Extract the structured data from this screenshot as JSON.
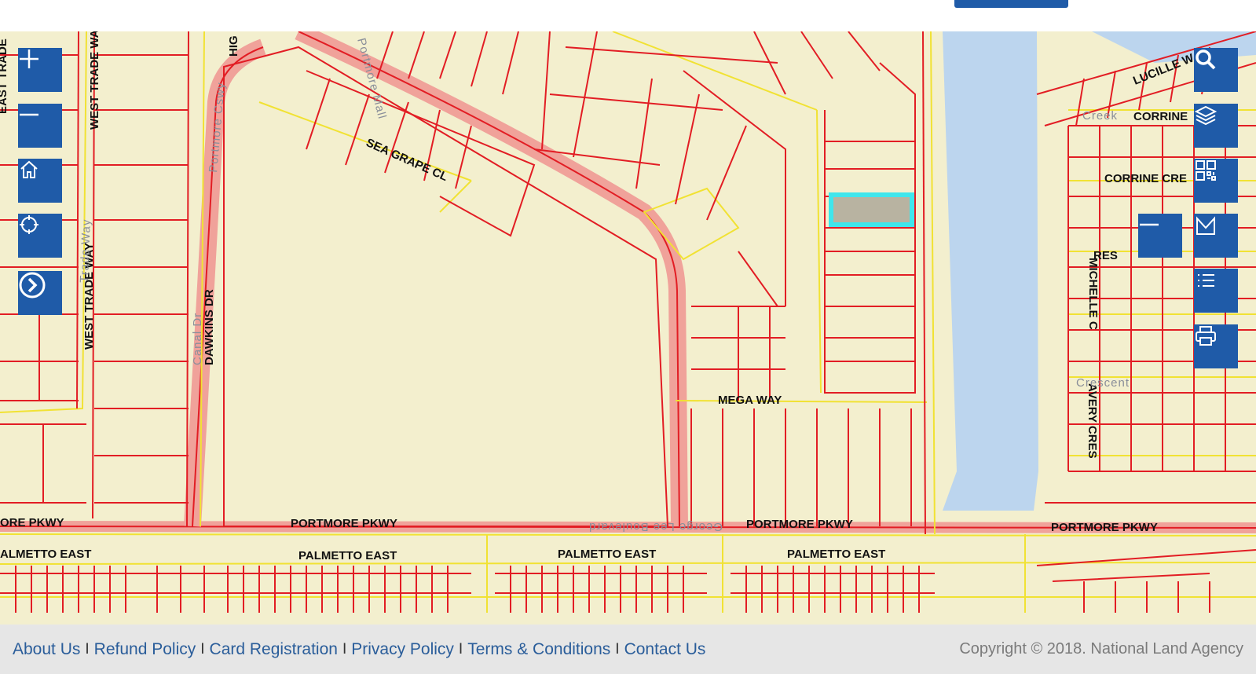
{
  "colors": {
    "parcel": "#e21d24",
    "road": "#f1e233",
    "highway": "#f0a29a",
    "water": "#bcd5ee",
    "land": "#f3efce",
    "control": "#1f5ba8",
    "highlight": "#3fe6ec",
    "selected_fill": "#b8b3a1"
  },
  "map": {
    "street_labels": [
      "WEST TRADE WAY",
      "WEST TRADE WAY",
      "EAST TRADE",
      "HIG",
      "Portmore Cswy",
      "Portmore Mall",
      "SEA GRAPE CL",
      "DAWKINS DR",
      "Canal Dr",
      "MEGA WAY",
      "PORTMORE PKWY",
      "PORTMORE PKWY",
      "PORTMORE PKWY",
      "ORE PKWY",
      "PALMETTO EAST",
      "PALMETTO EAST",
      "PALMETTO EAST",
      "ALMETTO EAST",
      "CORRINE",
      "CORRINE CRE",
      "LUCILLE W",
      "RES",
      "MICHELLE C",
      "AVERY CRES",
      "Creek",
      "Crescent",
      "George Lee Boulevard",
      "Trade Way"
    ]
  },
  "controls": {
    "left": [
      {
        "name": "zoom-in-button",
        "icon": "plus-icon"
      },
      {
        "name": "zoom-out-button",
        "icon": "minus-icon"
      },
      {
        "name": "home-button",
        "icon": "home-icon"
      },
      {
        "name": "locate-button",
        "icon": "crosshair-icon"
      },
      {
        "name": "expand-button",
        "icon": "chevron-right-circle-icon"
      }
    ],
    "right": [
      {
        "name": "search-button",
        "icon": "search-icon"
      },
      {
        "name": "layers-button",
        "icon": "layers-icon"
      },
      {
        "name": "qr-button",
        "icon": "qr-code-icon"
      },
      {
        "name": "measure-button",
        "icon": "measure-icon"
      },
      {
        "name": "legend-button",
        "icon": "list-icon"
      },
      {
        "name": "print-button",
        "icon": "print-icon"
      },
      {
        "name": "collapse-button",
        "icon": "minus-icon"
      }
    ]
  },
  "footer": {
    "links": [
      "About Us",
      "Refund Policy",
      "Card Registration",
      "Privacy Policy",
      "Terms & Conditions",
      "Contact Us"
    ],
    "separator": "I",
    "copyright": "Copyright © 2018. National Land Agency"
  }
}
